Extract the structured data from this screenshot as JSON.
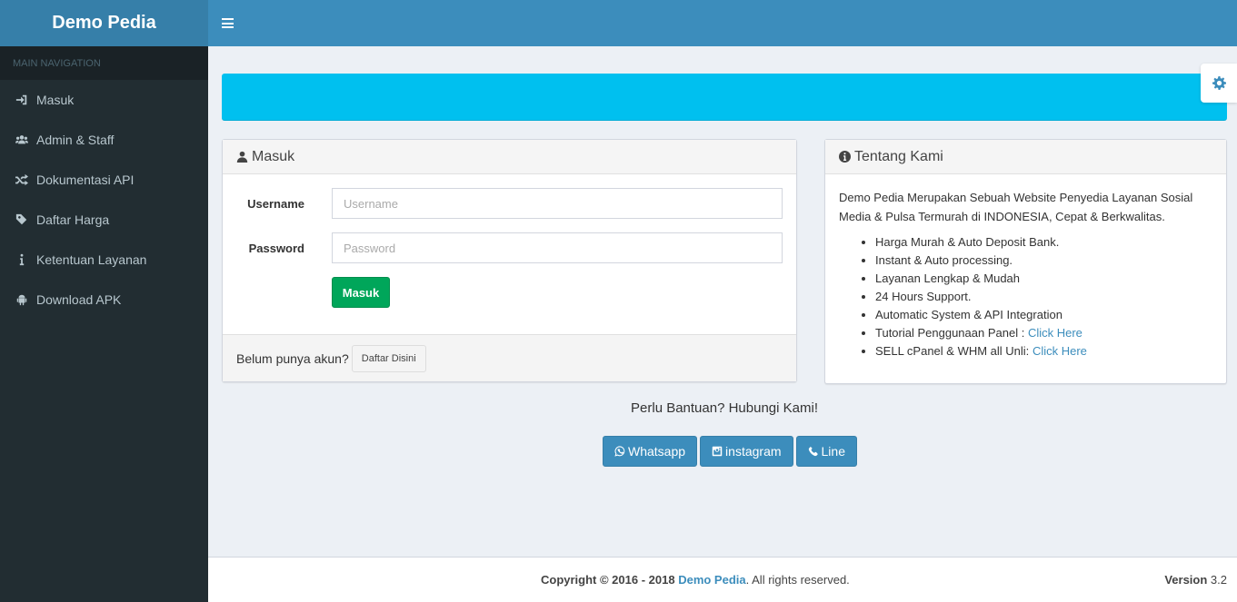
{
  "header": {
    "logo": "Demo Pedia"
  },
  "sidebar": {
    "section": "MAIN NAVIGATION",
    "items": [
      {
        "label": "Masuk",
        "icon": "sign-in-icon"
      },
      {
        "label": "Admin & Staff",
        "icon": "users-icon"
      },
      {
        "label": "Dokumentasi API",
        "icon": "random-icon"
      },
      {
        "label": "Daftar Harga",
        "icon": "tags-icon"
      },
      {
        "label": "Ketentuan Layanan",
        "icon": "info-icon"
      },
      {
        "label": "Download APK",
        "icon": "android-icon"
      }
    ]
  },
  "login": {
    "title": "Masuk",
    "username_label": "Username",
    "username_placeholder": "Username",
    "password_label": "Password",
    "password_placeholder": "Password",
    "submit": "Masuk",
    "footer_text": "Belum punya akun?",
    "register_button": "Daftar Disini"
  },
  "about": {
    "title": "Tentang Kami",
    "description": "Demo Pedia Merupakan Sebuah Website Penyedia Layanan Sosial Media & Pulsa Termurah di INDONESIA, Cepat & Berkwalitas.",
    "features": [
      "Harga Murah & Auto Deposit Bank.",
      "Instant & Auto processing.",
      "Layanan Lengkap & Mudah",
      "24 Hours Support.",
      "Automatic System & API Integration"
    ],
    "tutorial_text": "Tutorial Penggunaan Panel :",
    "tutorial_link": "Click Here",
    "sell_text": "SELL cPanel & WHM all Unli:",
    "sell_link": "Click Here"
  },
  "help": {
    "text": "Perlu Bantuan? Hubungi Kami!",
    "buttons": {
      "whatsapp": "Whatsapp",
      "instagram": "instagram",
      "line": "Line"
    }
  },
  "footer": {
    "copyright_prefix": "Copyright © 2016 - 2018",
    "brand": "Demo Pedia",
    "copyright_suffix": ". All rights reserved.",
    "version_label": "Version",
    "version_value": "3.2"
  },
  "colors": {
    "primary": "#3c8dbc",
    "callout": "#00c0ef",
    "success": "#00a65a",
    "sidebar": "#222d32"
  }
}
